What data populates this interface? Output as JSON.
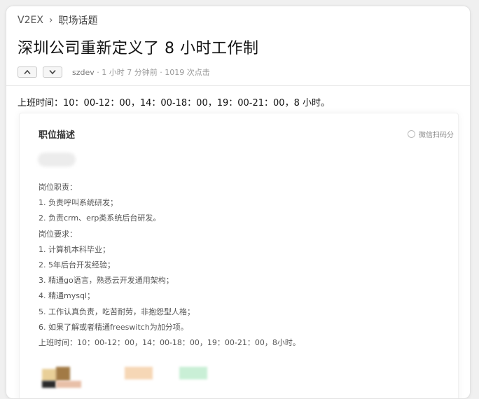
{
  "breadcrumb": {
    "site": "V2EX",
    "separator": "›",
    "node": "职场话题"
  },
  "topic": {
    "title": "深圳公司重新定义了 8 小时工作制",
    "author": "szdev",
    "meta": " · 1 小时 7 分钟前 · 1019 次点击"
  },
  "icons": {
    "upvote": "chevron-up-icon",
    "downvote": "chevron-down-icon",
    "scan": "circle-icon"
  },
  "content": {
    "work_hours": "上班时间：10：00-12：00，14：00-18：00，19：00-21：00，8 小时。",
    "section_title": "职位描述",
    "wechat_scan": "微信扫码分",
    "lines": [
      "岗位职责：",
      "1. 负责呼叫系统研发；",
      "2. 负责crm、erp类系统后台研发。",
      "岗位要求：",
      "1. 计算机本科毕业；",
      "2. 5年后台开发经验；",
      "3. 精通go语言，熟悉云开发通用架构；",
      "4. 精通mysql；",
      "5. 工作认真负责，吃苦耐劳，非抱怨型人格；",
      "6. 如果了解或者精通freeswitch为加分项。",
      "上班时间：10：00-12：00，14：00-18：00，19：00-21：00，8小时。"
    ]
  },
  "colors": {
    "page_bg": "#f0f0f0",
    "card_bg": "#ffffff",
    "title": "#111111",
    "meta": "#999999"
  }
}
